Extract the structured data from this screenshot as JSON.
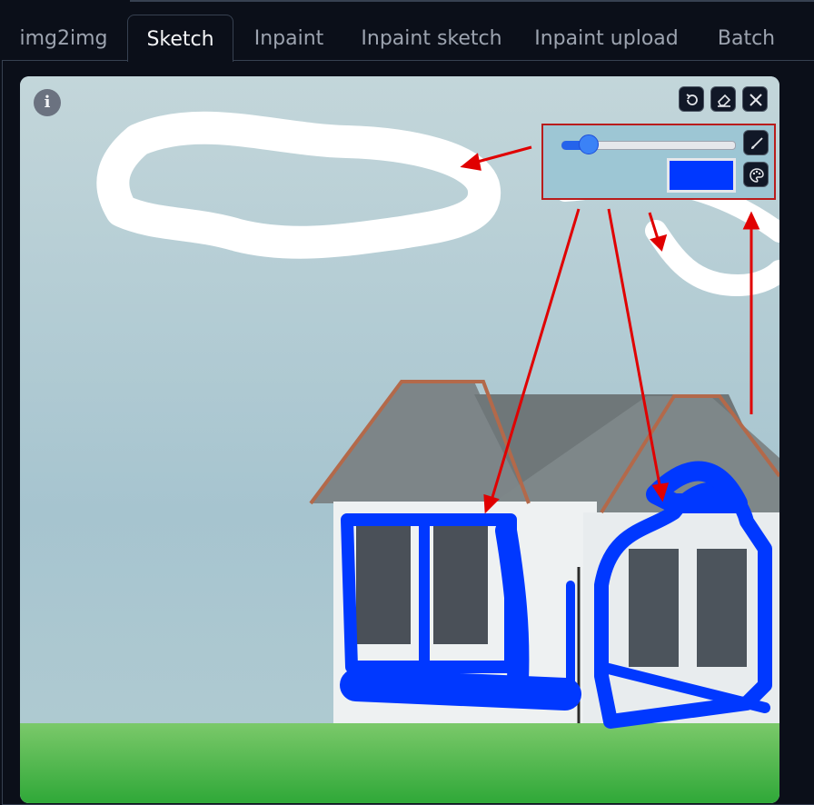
{
  "tabs": [
    {
      "label": "img2img",
      "active": false
    },
    {
      "label": "Sketch",
      "active": true
    },
    {
      "label": "Inpaint",
      "active": false
    },
    {
      "label": "Inpaint sketch",
      "active": false
    },
    {
      "label": "Inpaint upload",
      "active": false
    },
    {
      "label": "Batch",
      "active": false
    }
  ],
  "canvas": {
    "info_icon": "info-icon",
    "toolbar_icons": [
      "undo-icon",
      "eraser-icon",
      "close-icon"
    ]
  },
  "brush_controls": {
    "size_level": 0.16,
    "brush_color": "#0038ff",
    "brush_icon": "brush-icon",
    "palette_icon": "palette-icon"
  },
  "colors": {
    "background": "#0b0f19",
    "border": "#374151",
    "annotation": "#e00000",
    "sketch_blue": "#0038ff",
    "sketch_white": "#ffffff"
  }
}
